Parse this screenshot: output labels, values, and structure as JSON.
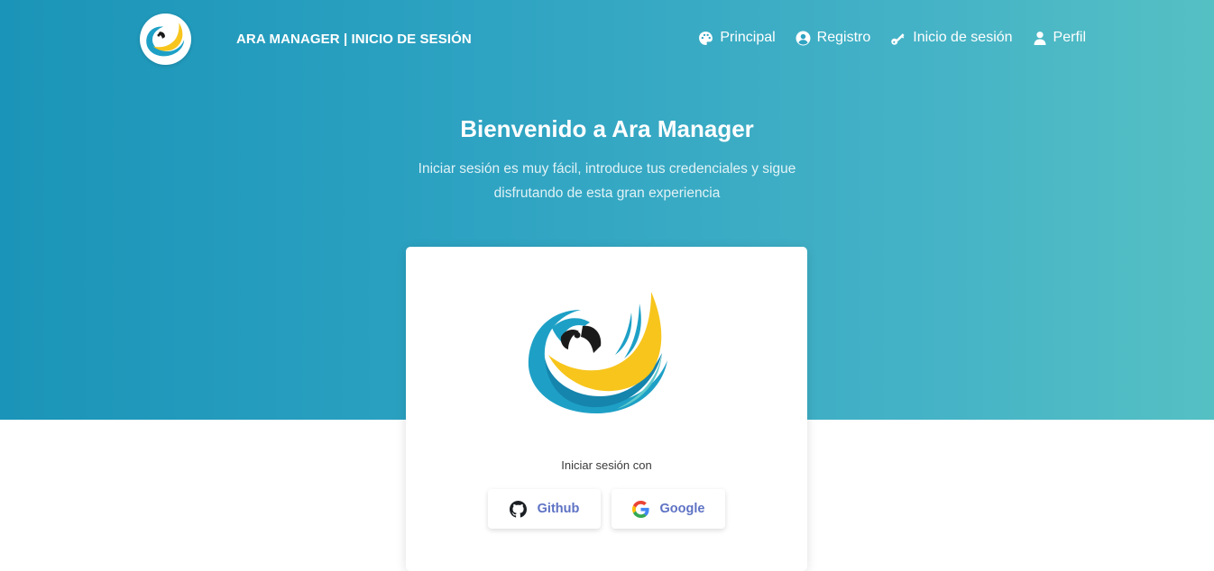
{
  "header": {
    "brand_title": "ARA MANAGER | INICIO DE SESIÓN",
    "nav": [
      {
        "label": "Principal",
        "icon": "palette-icon"
      },
      {
        "label": "Registro",
        "icon": "user-circle-icon"
      },
      {
        "label": "Inicio de sesión",
        "icon": "key-icon"
      },
      {
        "label": "Perfil",
        "icon": "user-icon"
      }
    ]
  },
  "hero": {
    "title": "Bienvenido a Ara Manager",
    "subtitle": "Iniciar sesión es muy fácil, introduce tus credenciales y sigue disfrutando de esta gran experiencia"
  },
  "login_card": {
    "caption": "Iniciar sesión con",
    "github_label": "Github",
    "google_label": "Google"
  },
  "colors": {
    "hero_gradient_start": "#1a94b8",
    "hero_gradient_end": "#55c0c4",
    "button_text": "#5e72c4",
    "parrot_blue": "#1ea0c6",
    "parrot_yellow": "#f7c51c"
  }
}
